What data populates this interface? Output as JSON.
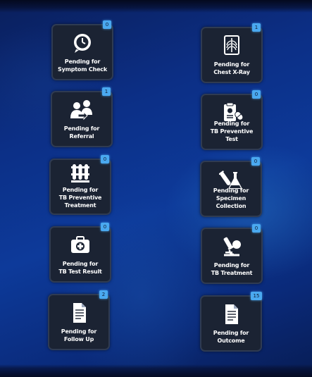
{
  "tiles": [
    {
      "label": "Pending for Symptom Check",
      "line1": "Pending for",
      "line2": "Symptom Check",
      "count": "0",
      "icon": "clock-chat-icon"
    },
    {
      "label": "Pending for Chest X-Ray",
      "line1": "Pending for",
      "line2": "Chest X-Ray",
      "count": "1",
      "icon": "xray-icon"
    },
    {
      "label": "Pending for Referral",
      "line1": "Pending for",
      "line2": "Referral",
      "count": "1",
      "icon": "referral-people-icon"
    },
    {
      "label": "Pending for TB Preventive Test",
      "line1": "Pending for",
      "line2": "TB Preventive Test",
      "count": "0",
      "icon": "clipboard-pill-icon"
    },
    {
      "label": "Pending for TB Preventive Treatment",
      "line1": "Pending for",
      "line2": "TB Preventive",
      "line3": "Treatment",
      "count": "0",
      "icon": "test-tubes-icon"
    },
    {
      "label": "Pending for Specimen Collection",
      "line1": "Pending for",
      "line2": "Specimen Collection",
      "count": "0",
      "icon": "lab-flask-icon"
    },
    {
      "label": "Pending for TB Test Result",
      "line1": "Pending for",
      "line2": "TB Test Result",
      "count": "0",
      "icon": "medical-kit-icon"
    },
    {
      "label": "Pending for TB Treatment",
      "line1": "Pending for",
      "line2": "TB Treatment",
      "count": "0",
      "icon": "microscope-icon"
    },
    {
      "label": "Pending for Follow Up",
      "line1": "Pending for",
      "line2": "Follow Up",
      "count": "2",
      "icon": "document-icon"
    },
    {
      "label": "Pending for Outcome",
      "line1": "Pending for",
      "line2": "Outcome",
      "count": "15",
      "icon": "document-icon"
    }
  ]
}
